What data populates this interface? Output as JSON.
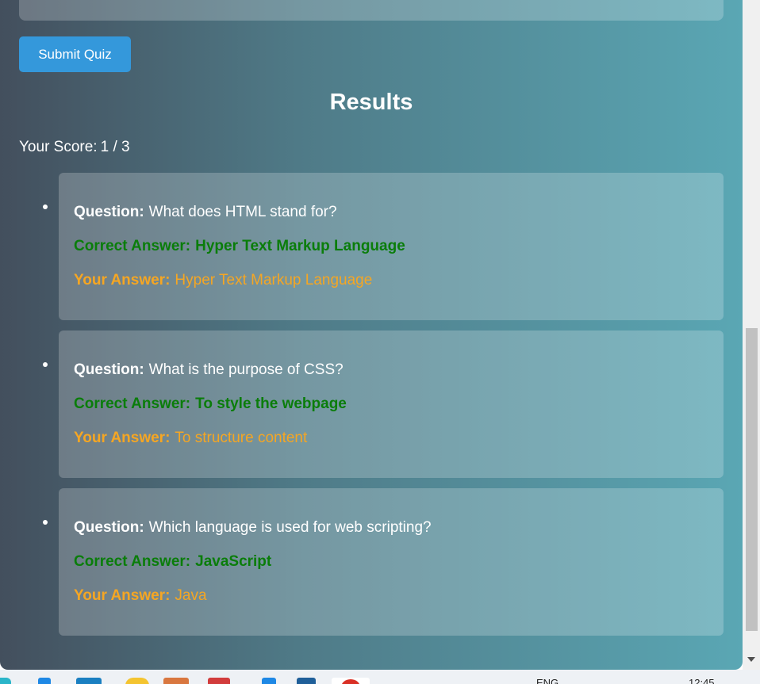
{
  "quiz": {
    "submit_label": "Submit Quiz"
  },
  "results": {
    "title": "Results",
    "score_label": "Your Score:",
    "score_value": "1 / 3",
    "question_label": "Question:",
    "correct_label": "Correct Answer:",
    "your_label": "Your Answer:",
    "items": [
      {
        "question": "What does HTML stand for?",
        "correct": "Hyper Text Markup Language",
        "yours": "Hyper Text Markup Language"
      },
      {
        "question": "What is the purpose of CSS?",
        "correct": "To style the webpage",
        "yours": "To structure content"
      },
      {
        "question": "Which language is used for web scripting?",
        "correct": "JavaScript",
        "yours": "Java"
      }
    ]
  },
  "colors": {
    "submit_button": "#3498db",
    "correct_answer": "#0a7d0a",
    "your_answer": "#f5a623"
  },
  "taskbar": {
    "language": "ENG",
    "clock": "12:45",
    "icons": [
      "widgets-icon",
      "taskview-icon",
      "weather-icon",
      "files-icon",
      "mail-icon",
      "edge-icon",
      "apps-icon",
      "chrome-icon"
    ]
  }
}
